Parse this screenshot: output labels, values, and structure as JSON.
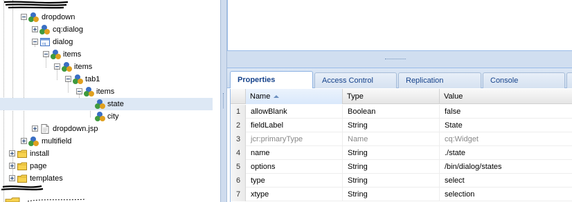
{
  "tree": {
    "items": [
      {
        "label": "dropdown",
        "icon": "node-icon"
      },
      {
        "label": "cq:dialog",
        "icon": "node-icon"
      },
      {
        "label": "dialog",
        "icon": "dialog-icon"
      },
      {
        "label": "items",
        "icon": "node-icon"
      },
      {
        "label": "items",
        "icon": "node-icon"
      },
      {
        "label": "tab1",
        "icon": "node-icon"
      },
      {
        "label": "items",
        "icon": "node-icon"
      },
      {
        "label": "state",
        "icon": "node-icon",
        "selected": true
      },
      {
        "label": "city",
        "icon": "node-icon"
      },
      {
        "label": "dropdown.jsp",
        "icon": "file-icon"
      },
      {
        "label": "multifield",
        "icon": "node-icon"
      },
      {
        "label": "install",
        "icon": "folder-icon"
      },
      {
        "label": "page",
        "icon": "folder-icon"
      },
      {
        "label": "templates",
        "icon": "folder-icon"
      }
    ]
  },
  "tabs": [
    {
      "label": "Properties",
      "active": true
    },
    {
      "label": "Access Control"
    },
    {
      "label": "Replication"
    },
    {
      "label": "Console"
    }
  ],
  "grid": {
    "columns": [
      "Name",
      "Type",
      "Value"
    ],
    "sorted_column": "Name",
    "rows": [
      {
        "num": "1",
        "name": "allowBlank",
        "type": "Boolean",
        "value": "false"
      },
      {
        "num": "2",
        "name": "fieldLabel",
        "type": "String",
        "value": "State"
      },
      {
        "num": "3",
        "name": "jcr:primaryType",
        "type": "Name",
        "value": "cq:Widget",
        "dim": true
      },
      {
        "num": "4",
        "name": "name",
        "type": "String",
        "value": "./state"
      },
      {
        "num": "5",
        "name": "options",
        "type": "String",
        "value": "/bin/dialog/states"
      },
      {
        "num": "6",
        "name": "type",
        "type": "String",
        "value": "select"
      },
      {
        "num": "7",
        "name": "xtype",
        "type": "String",
        "value": "selection"
      }
    ]
  },
  "colors": {
    "selection": "#dde8f5",
    "tab_text": "#15428b",
    "panel_border": "#99bbe8"
  }
}
